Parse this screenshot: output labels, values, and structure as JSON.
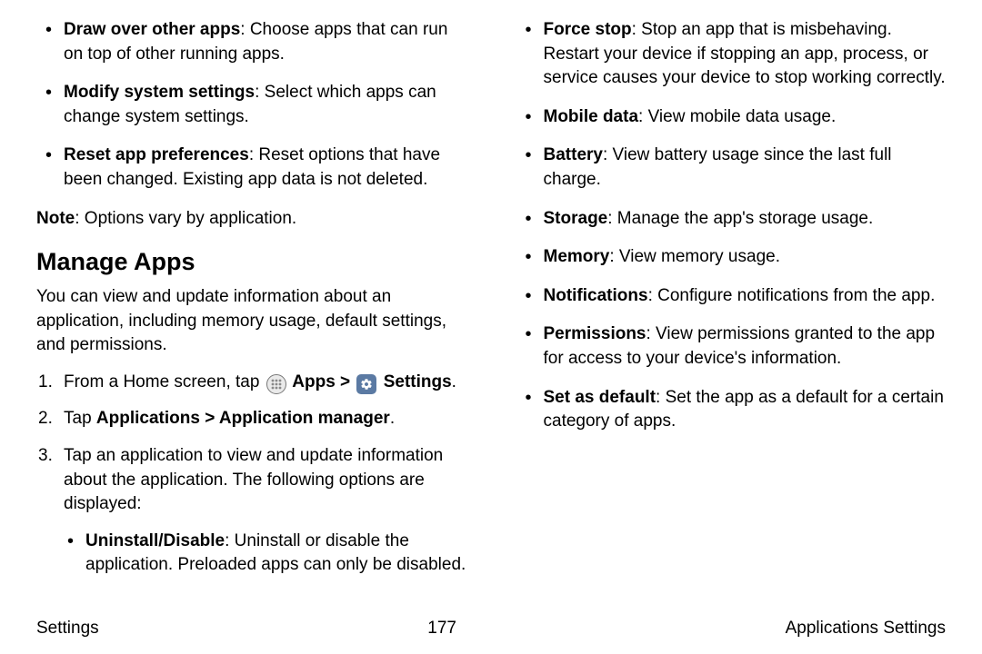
{
  "left": {
    "top_bullets": [
      {
        "term": "Draw over other apps",
        "desc": ": Choose apps that can run on top of other running apps."
      },
      {
        "term": "Modify system settings",
        "desc": ": Select which apps can change system settings."
      },
      {
        "term": "Reset app preferences",
        "desc": ": Reset options that have been changed. Existing app data is not deleted."
      }
    ],
    "note_label": "Note",
    "note_text": ": Options vary by application.",
    "heading": "Manage Apps",
    "intro": "You can view and update information about an application, including memory usage, default settings, and permissions.",
    "step1_pre": "From a Home screen, tap ",
    "step1_apps": " Apps > ",
    "step1_settings": " Settings",
    "step1_post": ".",
    "step2_pre": "Tap ",
    "step2_bold": "Applications > Application manager",
    "step2_post": ".",
    "step3": "Tap an application to view and update information about the application. The following options are displayed:",
    "step3_bullets": [
      {
        "term": "Uninstall/Disable",
        "desc": ": Uninstall or disable the application. Preloaded apps can only be disabled."
      }
    ]
  },
  "right": {
    "bullets": [
      {
        "term": "Force stop",
        "desc": ": Stop an app that is misbehaving. Restart your device if stopping an app, process, or service causes your device to stop working correctly."
      },
      {
        "term": "Mobile data",
        "desc": ": View mobile data usage."
      },
      {
        "term": "Battery",
        "desc": ": View battery usage since the last full charge."
      },
      {
        "term": "Storage",
        "desc": ": Manage the app's storage usage."
      },
      {
        "term": "Memory",
        "desc": ": View memory usage."
      },
      {
        "term": "Notifications",
        "desc": ": Configure notifications from the app."
      },
      {
        "term": "Permissions",
        "desc": ": View permissions granted to the app for access to your device's information."
      },
      {
        "term": "Set as default",
        "desc": ": Set the app as a default for a certain category of apps."
      }
    ]
  },
  "footer": {
    "left": "Settings",
    "center": "177",
    "right": "Applications Settings"
  }
}
